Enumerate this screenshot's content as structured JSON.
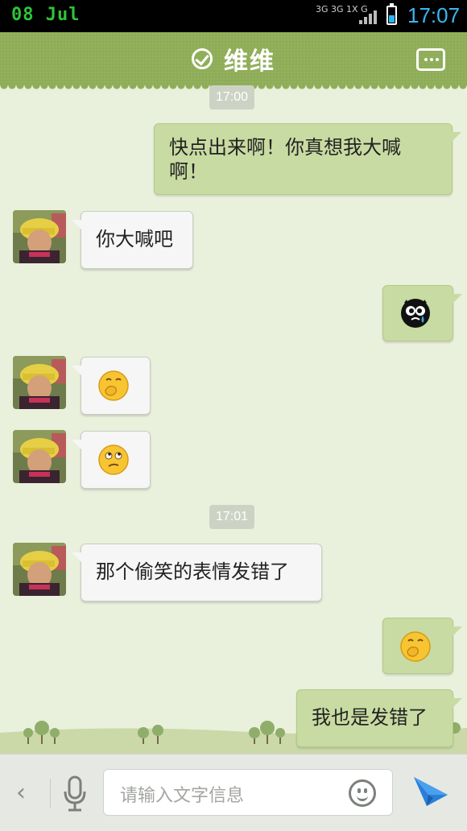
{
  "status_bar": {
    "date": "08 Jul",
    "signal_top": "3G 3G 1X G",
    "time": "17:07"
  },
  "title_bar": {
    "contact_name": "维维",
    "status_icon": "check-circle-icon",
    "menu_icon": "more-icon"
  },
  "messages": {
    "time_1": "17:00",
    "m1": "快点出来啊！你真想我大喊啊！",
    "m2": "你大喊吧",
    "m3_emoji": "crying-face-emoji",
    "m4_emoji": "snicker-emoji",
    "m5_emoji": "confused-emoji",
    "time_2": "17:01",
    "m6": "那个偷笑的表情发错了",
    "m7_emoji": "snicker-emoji",
    "m8": "我也是发错了"
  },
  "input_bar": {
    "placeholder": "请输入文字信息",
    "back_icon": "chevron-left-icon",
    "mic_icon": "microphone-icon",
    "emoji_icon": "smiley-icon",
    "send_icon": "send-icon"
  },
  "colors": {
    "title_bg": "#8fad58",
    "chat_bg": "#e9f0dc",
    "right_bubble": "#c8dba2",
    "left_bubble": "#f6f6f6",
    "accent_blue": "#3ab8f0"
  }
}
